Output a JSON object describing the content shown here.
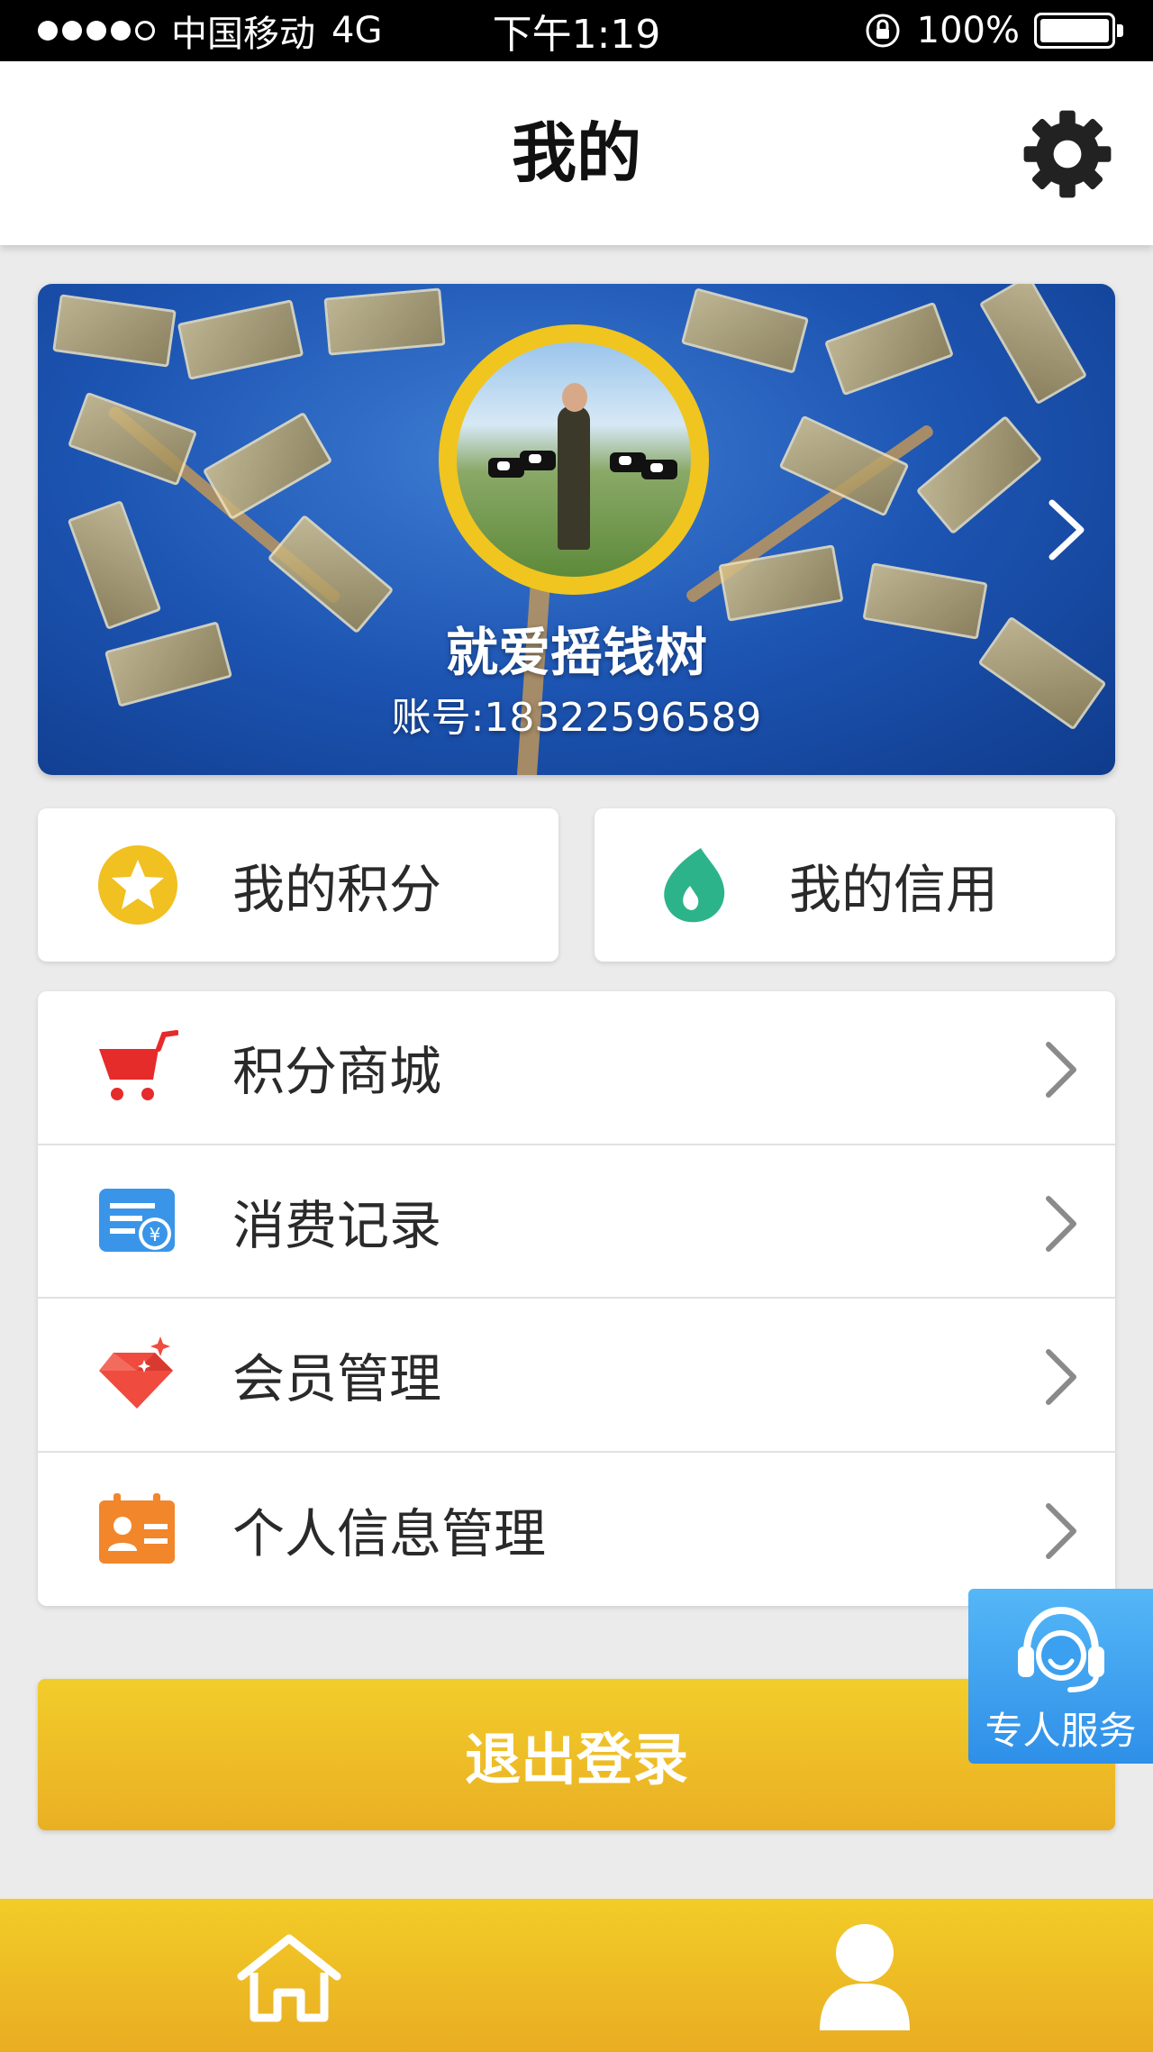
{
  "status_bar": {
    "carrier": "中国移动",
    "network": "4G",
    "time": "下午1:19",
    "battery": "100%"
  },
  "nav": {
    "title": "我的",
    "settings_icon": "gear-icon"
  },
  "profile": {
    "name": "就爱摇钱树",
    "account": "账号:18322596589"
  },
  "tiles": [
    {
      "label": "我的积分",
      "icon": "star-icon",
      "color": "#f1c021"
    },
    {
      "label": "我的信用",
      "icon": "drop-icon",
      "color": "#2db38a"
    }
  ],
  "menu": [
    {
      "label": "积分商城",
      "icon": "cart-icon",
      "color": "#e62b2b"
    },
    {
      "label": "消费记录",
      "icon": "receipt-icon",
      "color": "#3a95e8"
    },
    {
      "label": "会员管理",
      "icon": "diamond-icon",
      "color": "#ef4b3f"
    },
    {
      "label": "个人信息管理",
      "icon": "id-card-icon",
      "color": "#f2862a"
    }
  ],
  "service": {
    "label": "专人服务",
    "icon": "headset-icon"
  },
  "logout": {
    "label": "退出登录"
  },
  "tab_bar": {
    "items": [
      {
        "icon": "home-icon"
      },
      {
        "icon": "person-icon"
      }
    ]
  },
  "colors": {
    "accent_yellow": "#f0c520",
    "service_blue": "#2e8fe8",
    "background": "#ebebeb"
  }
}
